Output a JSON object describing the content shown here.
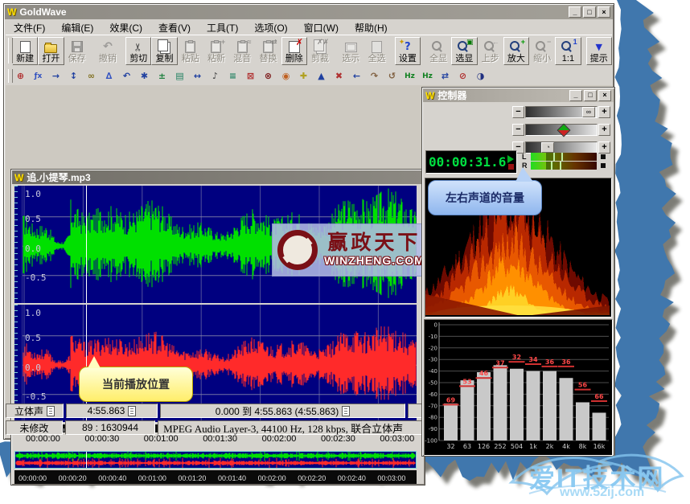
{
  "app": {
    "title": "GoldWave",
    "window_buttons": {
      "minimize": "_",
      "maximize": "□",
      "close": "×"
    }
  },
  "menu": {
    "items": [
      "文件(F)",
      "编辑(E)",
      "效果(C)",
      "查看(V)",
      "工具(T)",
      "选项(O)",
      "窗口(W)",
      "帮助(H)"
    ]
  },
  "toolbar": {
    "buttons": [
      {
        "label": "新建",
        "icon": "new-file-icon",
        "enabled": true,
        "gap": false
      },
      {
        "label": "打开",
        "icon": "open-file-icon",
        "enabled": true,
        "gap": false
      },
      {
        "label": "保存",
        "icon": "save-icon",
        "enabled": false,
        "gap": false
      },
      {
        "label": "撤销",
        "icon": "undo-icon",
        "enabled": false,
        "gap": true
      },
      {
        "label": "剪切",
        "icon": "cut-icon",
        "enabled": true,
        "gap": true
      },
      {
        "label": "复制",
        "icon": "copy-icon",
        "enabled": true,
        "gap": false
      },
      {
        "label": "粘贴",
        "icon": "paste-icon",
        "enabled": false,
        "gap": false
      },
      {
        "label": "粘新",
        "icon": "paste-new-icon",
        "enabled": false,
        "gap": false
      },
      {
        "label": "混音",
        "icon": "mix-icon",
        "enabled": false,
        "gap": false
      },
      {
        "label": "替换",
        "icon": "replace-icon",
        "enabled": false,
        "gap": false
      },
      {
        "label": "删除",
        "icon": "delete-icon",
        "enabled": true,
        "gap": false
      },
      {
        "label": "剪裁",
        "icon": "trim-icon",
        "enabled": false,
        "gap": false
      },
      {
        "label": "选示",
        "icon": "show-selection-icon",
        "enabled": false,
        "gap": true
      },
      {
        "label": "全选",
        "icon": "select-all-icon",
        "enabled": false,
        "gap": false
      },
      {
        "label": "设置",
        "icon": "settings-icon",
        "enabled": true,
        "gap": true
      },
      {
        "label": "全显",
        "icon": "show-all-icon",
        "enabled": false,
        "gap": true
      },
      {
        "label": "选显",
        "icon": "zoom-selection-icon",
        "enabled": true,
        "gap": false
      },
      {
        "label": "上步",
        "icon": "zoom-previous-icon",
        "enabled": false,
        "gap": false
      },
      {
        "label": "放大",
        "icon": "zoom-in-icon",
        "enabled": true,
        "gap": false
      },
      {
        "label": "缩小",
        "icon": "zoom-out-icon",
        "enabled": false,
        "gap": false
      },
      {
        "label": "1:1",
        "icon": "zoom-1-1-icon",
        "enabled": true,
        "gap": false
      },
      {
        "label": "提示",
        "icon": "hint-dropdown-icon",
        "enabled": true,
        "gap": true
      }
    ]
  },
  "toolbar2": {
    "icons": [
      {
        "name": "device-controls-icon",
        "glyph": "⊕",
        "color": "#b03030"
      },
      {
        "name": "expression-evaluator-icon",
        "glyph": "ƒx",
        "color": "#3050c0"
      },
      {
        "name": "goto-end-icon",
        "glyph": "→",
        "color": "#2040a0"
      },
      {
        "name": "expand-icon",
        "glyph": "↕",
        "color": "#2040a0"
      },
      {
        "name": "doppler-icon",
        "glyph": "∞",
        "color": "#807020"
      },
      {
        "name": "dynamics-icon",
        "glyph": "∆",
        "color": "#3050c0"
      },
      {
        "name": "echo-icon",
        "glyph": "↶",
        "color": "#2040a0"
      },
      {
        "name": "filter-icon",
        "glyph": "✱",
        "color": "#2040a0"
      },
      {
        "name": "flanger-icon",
        "glyph": "±",
        "color": "#208040"
      },
      {
        "name": "mechanize-icon",
        "glyph": "▤",
        "color": "#208060"
      },
      {
        "name": "offset-icon",
        "glyph": "↔",
        "color": "#2040a0"
      },
      {
        "name": "pitch-icon",
        "glyph": "♪",
        "color": "#404040"
      },
      {
        "name": "reverb-icon",
        "glyph": "≡",
        "color": "#208060"
      },
      {
        "name": "invert-icon",
        "glyph": "⊠",
        "color": "#b03030"
      },
      {
        "name": "resample-icon",
        "glyph": "⊗",
        "color": "#802020"
      },
      {
        "name": "time-warp-icon",
        "glyph": "◉",
        "color": "#c06020"
      },
      {
        "name": "volume-shape-icon",
        "glyph": "✚",
        "color": "#b0a020"
      },
      {
        "name": "fade-icon",
        "glyph": "▲",
        "color": "#2040a0"
      },
      {
        "name": "mute-icon",
        "glyph": "✖",
        "color": "#b03030"
      },
      {
        "name": "trim-silence-icon",
        "glyph": "←",
        "color": "#2040a0"
      },
      {
        "name": "loop-icon",
        "glyph": "↷",
        "color": "#806040"
      },
      {
        "name": "rewind-icon",
        "glyph": "↺",
        "color": "#806040"
      },
      {
        "name": "hz-up-icon",
        "glyph": "Hz",
        "color": "#108020"
      },
      {
        "name": "hz-convert-icon",
        "glyph": "Hz",
        "color": "#108020"
      },
      {
        "name": "cycle-icon",
        "glyph": "⇄",
        "color": "#2040a0"
      },
      {
        "name": "speaker-off-icon",
        "glyph": "⊘",
        "color": "#b03030"
      },
      {
        "name": "timer-icon",
        "glyph": "◑",
        "color": "#203080"
      }
    ]
  },
  "sound_window": {
    "title": "追.小提琴.mp3",
    "amplitude_labels": [
      "1.0",
      "0.5",
      "0.0",
      "-0.5"
    ],
    "ruler_labels": [
      "00:00:00",
      "00:00:30",
      "00:01:00",
      "00:01:30",
      "00:02:00",
      "00:02:30",
      "00:03:00"
    ],
    "overview_ruler_labels": [
      "00:00:00",
      "00:00:20",
      "00:00:40",
      "00:01:00",
      "00:01:20",
      "00:01:40",
      "00:02:00",
      "00:02:20",
      "00:02:40",
      "00:03:00"
    ]
  },
  "controller": {
    "title": "控制器",
    "time": "00:00:31.6",
    "meter_labels": [
      "L",
      "R"
    ],
    "slider_minus": "−",
    "slider_plus": "+"
  },
  "chart_data": {
    "type": "bar",
    "title": "",
    "xlabel": "",
    "ylabel": "",
    "categories": [
      "32",
      "63",
      "126",
      "252",
      "504",
      "1k",
      "2k",
      "4k",
      "8k",
      "16k"
    ],
    "values": [
      -68,
      -48,
      -41,
      -35,
      -38,
      -40,
      -40,
      -46,
      -67,
      -76
    ],
    "peaks": [
      69,
      53,
      46,
      37,
      32,
      34,
      36,
      36,
      56,
      66
    ],
    "y_ticks": [
      0,
      -10,
      -20,
      -30,
      -40,
      -50,
      -60,
      -70,
      -80,
      -90,
      -100
    ],
    "ylim": [
      -100,
      0
    ],
    "grid": true,
    "legend": false
  },
  "status": {
    "row1": [
      "立体声",
      "4:55.863",
      "0.000 到 4:55.863 (4:55.863)"
    ],
    "row2": [
      "未修改",
      "89 : 1630944",
      "MPEG Audio Layer-3, 44100 Hz, 128 kbps, 联合立体声"
    ]
  },
  "tooltips": {
    "meter": "左右声道的音量",
    "position": "当前播放位置"
  },
  "watermarks": {
    "center_title": "赢政天下",
    "center_domain": "WINZHENG.COM",
    "corner_title": "爱IT技术网",
    "corner_domain": "www.52ij.com"
  },
  "colors": {
    "torn_blue": "#4077ad",
    "waveform_green": "#00e000",
    "waveform_red": "#ff2a2a",
    "panel_navy": "#000080",
    "lcd_green": "#00e040"
  }
}
